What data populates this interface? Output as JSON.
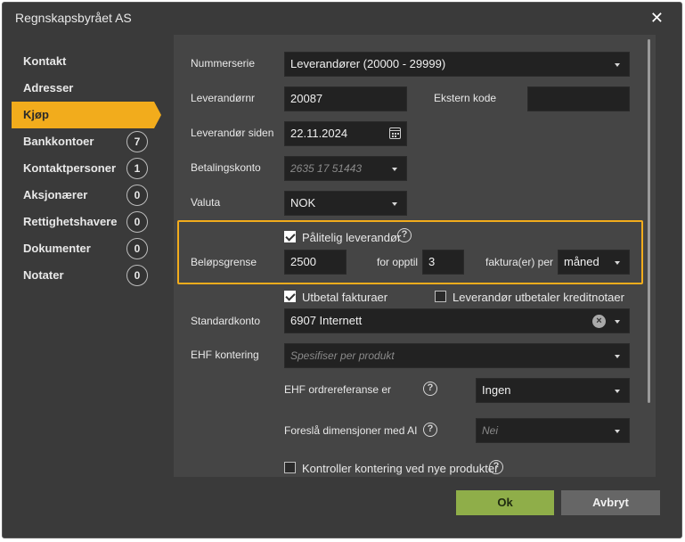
{
  "dialog": {
    "title": "Regnskapsbyrået AS"
  },
  "sidebar": {
    "items": [
      {
        "label": "Kontakt",
        "badge": null
      },
      {
        "label": "Adresser",
        "badge": null
      },
      {
        "label": "Kjøp",
        "badge": null,
        "active": true
      },
      {
        "label": "Bankkontoer",
        "badge": "7"
      },
      {
        "label": "Kontaktpersoner",
        "badge": "1"
      },
      {
        "label": "Aksjonærer",
        "badge": "0"
      },
      {
        "label": "Rettighetshavere",
        "badge": "0"
      },
      {
        "label": "Dokumenter",
        "badge": "0"
      },
      {
        "label": "Notater",
        "badge": "0"
      }
    ]
  },
  "form": {
    "nummerserie": {
      "label": "Nummerserie",
      "value": "Leverandører (20000 - 29999)"
    },
    "leverandornr": {
      "label": "Leverandørnr",
      "value": "20087"
    },
    "ekstern_kode": {
      "label": "Ekstern kode",
      "value": ""
    },
    "leverandor_siden": {
      "label": "Leverandør siden",
      "value": "22.11.2024"
    },
    "betalingskonto": {
      "label": "Betalingskonto",
      "placeholder": "2635 17 51443"
    },
    "valuta": {
      "label": "Valuta",
      "value": "NOK"
    },
    "palitelig": {
      "label": "Pålitelig leverandør",
      "checked": true
    },
    "belopsgrense": {
      "label": "Beløpsgrense",
      "value": "2500",
      "for_opptil": "for opptil",
      "count": "3",
      "per_label": "faktura(er) per",
      "period": "måned"
    },
    "utbetal_fakturaer": {
      "label": "Utbetal fakturaer",
      "checked": true
    },
    "kreditnotaer": {
      "label": "Leverandør utbetaler kreditnotaer",
      "checked": false
    },
    "standardkonto": {
      "label": "Standardkonto",
      "value": "6907 Internett"
    },
    "ehf_kontering": {
      "label": "EHF kontering",
      "placeholder": "Spesifiser per produkt"
    },
    "ehf_ordrereferanse": {
      "label": "EHF ordrereferanse er",
      "value": "Ingen"
    },
    "foresla_dimensjoner": {
      "label": "Foreslå dimensjoner med AI",
      "placeholder": "Nei"
    },
    "kontroller_kontering": {
      "label": "Kontroller kontering ved nye produkter",
      "checked": false
    }
  },
  "footer": {
    "ok_label": "Ok",
    "cancel_label": "Avbryt"
  },
  "colors": {
    "accent": "#f2ac1c",
    "ok_button": "#8fae49",
    "background": "#3a3a3a",
    "panel": "#454545"
  }
}
